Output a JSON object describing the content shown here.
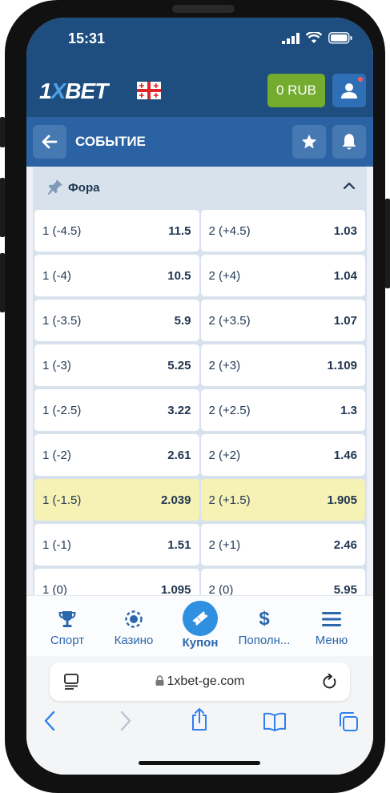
{
  "status": {
    "time": "15:31"
  },
  "header": {
    "logo_prefix": "1",
    "logo_x": "X",
    "logo_suffix": "BET",
    "balance": "0 RUB"
  },
  "event": {
    "title": "СОБЫТИЕ"
  },
  "section": {
    "title": "Фора"
  },
  "odds_rows": [
    {
      "left_label": "1 (-4.5)",
      "left_value": "11.5",
      "right_label": "2 (+4.5)",
      "right_value": "1.03"
    },
    {
      "left_label": "1 (-4)",
      "left_value": "10.5",
      "right_label": "2 (+4)",
      "right_value": "1.04"
    },
    {
      "left_label": "1 (-3.5)",
      "left_value": "5.9",
      "right_label": "2 (+3.5)",
      "right_value": "1.07"
    },
    {
      "left_label": "1 (-3)",
      "left_value": "5.25",
      "right_label": "2 (+3)",
      "right_value": "1.109"
    },
    {
      "left_label": "1 (-2.5)",
      "left_value": "3.22",
      "right_label": "2 (+2.5)",
      "right_value": "1.3"
    },
    {
      "left_label": "1 (-2)",
      "left_value": "2.61",
      "right_label": "2 (+2)",
      "right_value": "1.46"
    },
    {
      "left_label": "1 (-1.5)",
      "left_value": "2.039",
      "right_label": "2 (+1.5)",
      "right_value": "1.905"
    },
    {
      "left_label": "1 (-1)",
      "left_value": "1.51",
      "right_label": "2 (+1)",
      "right_value": "2.46"
    },
    {
      "left_label": "1 (0)",
      "left_value": "1.095",
      "right_label": "2 (0)",
      "right_value": "5.95"
    }
  ],
  "nav": {
    "sport": "Спорт",
    "casino": "Казино",
    "coupon": "Купон",
    "deposit": "Пополн...",
    "menu": "Меню"
  },
  "browser": {
    "url": "1xbet-ge.com"
  },
  "colors": {
    "header_bg": "#1e4d7f",
    "event_bar_bg": "#2a62a3",
    "balance_green": "#73ac2f",
    "highlight_row": "#f6f1b4",
    "nav_blue": "#2b67ad"
  }
}
